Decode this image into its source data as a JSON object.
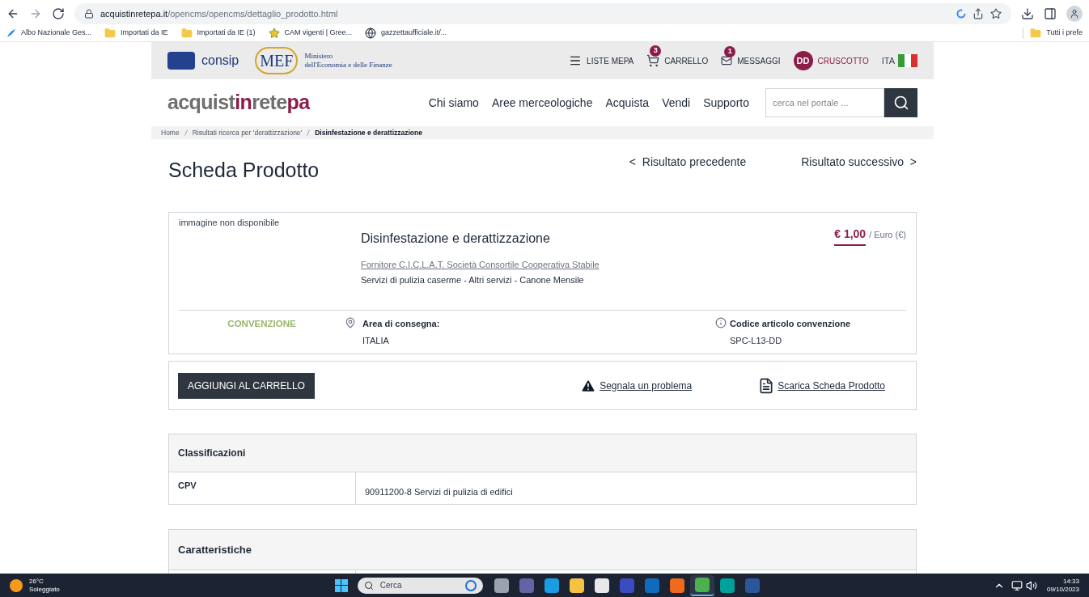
{
  "browser": {
    "url_host": "acquistinretepa.it",
    "url_path": "/opencms/opencms/dettaglio_prodotto.html",
    "bookmarks": [
      {
        "label": "Albo Nazionale Ges...",
        "kind": "site"
      },
      {
        "label": "Importati da IE",
        "kind": "folder"
      },
      {
        "label": "Importati da IE (1)",
        "kind": "folder"
      },
      {
        "label": "CAM vigenti | Gree...",
        "kind": "star"
      },
      {
        "label": "gazzettaufficiale.it/...",
        "kind": "globe"
      }
    ],
    "other_bookmarks": "Tutti i prefe"
  },
  "top_bar": {
    "consip": "consip",
    "mef_logo": "MEF",
    "mef_text_1": "Ministero",
    "mef_text_2": "dell'Economia e delle Finanze",
    "items": [
      {
        "label": "LISTE MEPA",
        "kind": "menu"
      },
      {
        "label": "CARRELLO",
        "kind": "cart",
        "badge": "3"
      },
      {
        "label": "MESSAGGI",
        "kind": "mail",
        "badge": "1"
      },
      {
        "label": "CRUSCOTTO",
        "kind": "user",
        "initials": "DD"
      }
    ],
    "language": "ITA"
  },
  "logo": [
    {
      "text": "acquist",
      "accent": false
    },
    {
      "text": "in",
      "accent": true
    },
    {
      "text": "rete",
      "accent": false
    },
    {
      "text": "pa",
      "accent": true
    }
  ],
  "nav": [
    "Chi siamo",
    "Aree merceologiche",
    "Acquista",
    "Vendi",
    "Supporto"
  ],
  "search": {
    "placeholder": "cerca nel portale ..."
  },
  "breadcrumb": [
    {
      "label": "Home",
      "selected": false
    },
    {
      "label": "Risultati ricerca per 'derattizzazione'",
      "selected": false
    },
    {
      "label": "Disinfestazione e derattizzazione",
      "selected": true
    }
  ],
  "page_title": "Scheda Prodotto",
  "prev": "<  Risultato precedente",
  "next": "Risultato successivo  >",
  "product": {
    "image_alt": "immagine non disponibile",
    "name": "Disinfestazione e derattizzazione",
    "price": "€ 1,00",
    "unit": "/ Euro (€)",
    "supplier": "Fornitore C.I.C.L.A.T. Società Consortile Cooperativa Stabile",
    "category": "Servizi di pulizia caserme - Altri servizi - Canone Mensile",
    "type": "CONVENZIONE",
    "area_label": "Area di consegna:",
    "area_value": "ITALIA",
    "code_label": "Codice articolo convenzione",
    "code_value": "SPC-L13-DD"
  },
  "actions": {
    "add_to_cart": "AGGIUNGI AL CARRELLO",
    "report": "Segnala un problema",
    "download": "Scarica Scheda Prodotto"
  },
  "classificazioni": {
    "title": "Classificazioni",
    "rows": [
      {
        "label": "CPV",
        "value": "90911200-8 Servizi di pulizia di edifici"
      }
    ]
  },
  "caratteristiche": {
    "title": "Caratteristiche"
  },
  "taskbar": {
    "temperature": "26°C",
    "weather": "Soleggiato",
    "search_placeholder": "Cerca",
    "time": "14:33",
    "date": "09/10/2023",
    "apps": [
      {
        "kind": "taskview",
        "selected": false
      },
      {
        "kind": "chat",
        "selected": false
      },
      {
        "kind": "edge",
        "selected": false
      },
      {
        "kind": "files",
        "selected": false
      },
      {
        "kind": "store",
        "selected": false
      },
      {
        "kind": "tool",
        "selected": false
      },
      {
        "kind": "mail",
        "selected": false
      },
      {
        "kind": "orange",
        "selected": false
      },
      {
        "kind": "chrome",
        "selected": true
      },
      {
        "kind": "eset",
        "selected": false
      },
      {
        "kind": "word",
        "selected": false
      }
    ]
  }
}
